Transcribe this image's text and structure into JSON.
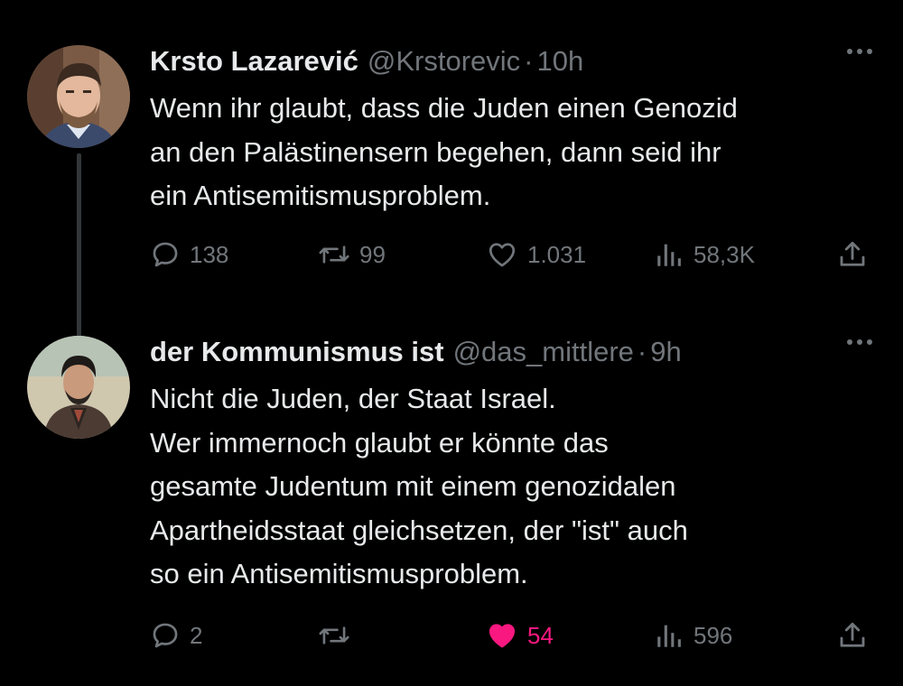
{
  "tweets": [
    {
      "author_name": "Krsto Lazarević",
      "handle": "@Krstorevic",
      "separator": "·",
      "time": "10h",
      "lines": [
        "Wenn ihr glaubt, dass die Juden einen Genozid",
        "an den Palästinensern begehen, dann seid ihr",
        "ein Antisemitismusproblem."
      ],
      "replies": "138",
      "retweets": "99",
      "likes": "1.031",
      "views": "58,3K",
      "liked": false
    },
    {
      "author_name": "der Kommunismus ist",
      "handle": "@das_mittlere",
      "separator": "·",
      "time": "9h",
      "lines": [
        "Nicht die Juden, der Staat Israel.",
        "Wer immernoch glaubt er könnte das",
        "gesamte Judentum mit einem genozidalen",
        "Apartheidsstaat gleichsetzen, der \"ist\" auch",
        "so ein Antisemitismusproblem."
      ],
      "replies": "2",
      "retweets": "",
      "likes": "54",
      "views": "596",
      "liked": true
    }
  ],
  "icons": {
    "reply": "reply-icon",
    "retweet": "retweet-icon",
    "like": "heart-icon",
    "views": "views-icon",
    "share": "share-icon",
    "more": "more-icon"
  },
  "colors": {
    "background": "#000000",
    "text": "#e7e9ea",
    "muted": "#71767b",
    "like_active": "#f91880",
    "thread_line": "#333639"
  }
}
